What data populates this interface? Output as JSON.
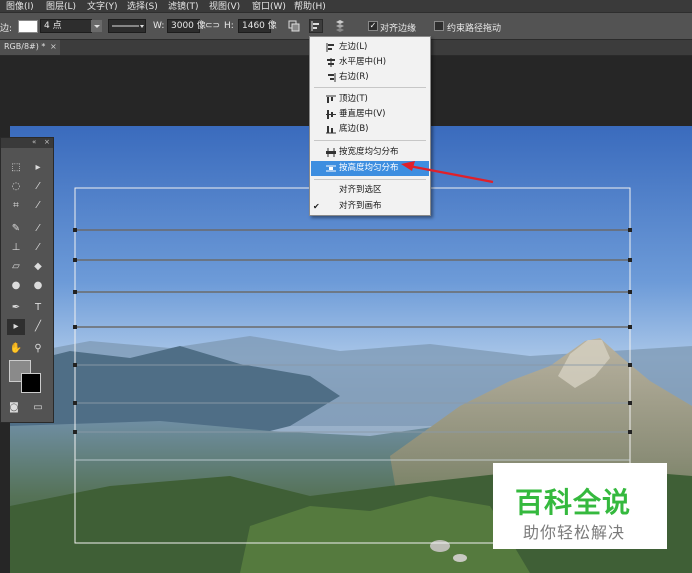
{
  "menubar": {
    "items": [
      "图像(I)",
      "图层(L)",
      "文字(Y)",
      "选择(S)",
      "滤镜(T)",
      "视图(V)",
      "窗口(W)",
      "帮助(H)"
    ]
  },
  "options": {
    "stroke_label": "边:",
    "stroke_size": "4 点",
    "width_label": "W:",
    "width_value": "3000 像",
    "height_label": "H:",
    "height_value": "1460 像",
    "align_edges_label": "对齐边缘",
    "constrain_label": "约束路径拖动",
    "align_edges_checked": true,
    "constrain_checked": false
  },
  "document": {
    "tab_label": "RGB/8#) *",
    "tab_close": "×"
  },
  "tools_panel": {
    "collapse": "«",
    "close": "×"
  },
  "align_menu": {
    "items": [
      {
        "label": "左边(L)",
        "icon": "align-left-icon"
      },
      {
        "label": "水平居中(H)",
        "icon": "align-hcenter-icon"
      },
      {
        "label": "右边(R)",
        "icon": "align-right-icon"
      },
      {
        "label": "顶边(T)",
        "icon": "align-top-icon"
      },
      {
        "label": "垂直居中(V)",
        "icon": "align-vcenter-icon"
      },
      {
        "label": "底边(B)",
        "icon": "align-bottom-icon"
      },
      {
        "label": "按宽度均匀分布",
        "icon": "distribute-width-icon"
      },
      {
        "label": "按高度均匀分布",
        "icon": "distribute-height-icon"
      },
      {
        "label": "对齐到选区",
        "icon": ""
      },
      {
        "label": "对齐到画布",
        "icon": ""
      }
    ],
    "highlighted": "按高度均匀分布",
    "checked": "对齐到画布",
    "check_glyph": "✔"
  },
  "watermark": {
    "title": "百科全说",
    "subtitle": "助你轻松解决"
  },
  "colors": {
    "highlight": "#3d8ee0",
    "arrow": "#e0202a",
    "watermark_green": "#35b93e"
  }
}
